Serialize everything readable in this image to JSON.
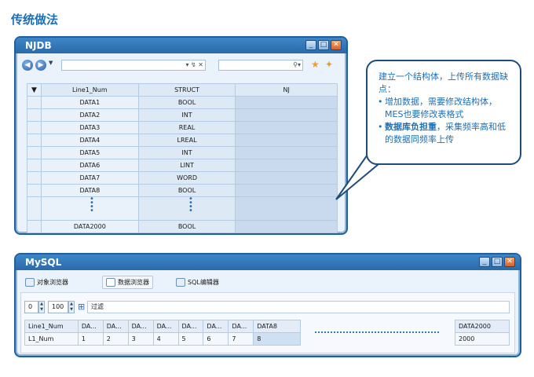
{
  "page_title": "传统做法",
  "njdb": {
    "title": "NJDB",
    "window_buttons": [
      "_",
      "□",
      "✕"
    ],
    "toolbar": {
      "back_icon": "back-arrow-icon",
      "forward_icon": "forward-arrow-icon",
      "search_icon": "search-icon",
      "star_icon": "star-icon"
    },
    "columns": [
      "Line1_Num",
      "STRUCT",
      "NJ"
    ],
    "sort_glyph": "▼",
    "rows": [
      [
        "DATA1",
        "BOOL"
      ],
      [
        "DATA2",
        "INT"
      ],
      [
        "DATA3",
        "REAL"
      ],
      [
        "DATA4",
        "LREAL"
      ],
      [
        "DATA5",
        "INT"
      ],
      [
        "DATA6",
        "LINT"
      ],
      [
        "DATA7",
        "WORD"
      ],
      [
        "DATA8",
        "BOOL"
      ]
    ],
    "last_row": [
      "DATA2000",
      "BOOL"
    ]
  },
  "callout": {
    "intro": "建立一个结构体，上传所有数据缺点：",
    "bullet1": "增加数据，需要修改结构体，MES也要修改表格式",
    "bullet2_bold": "数据库负担重",
    "bullet2_rest": "，采集频率高和低的数据同频率上传"
  },
  "mysql": {
    "title": "MySQL",
    "window_buttons": [
      "_",
      "□",
      "✕"
    ],
    "tabs": [
      "对象浏览器",
      "数据浏览器",
      "SQL编辑器"
    ],
    "active_tab": 1,
    "offset_value": "0",
    "limit_value": "100",
    "filter_label": "过滤",
    "header": [
      "Line1_Num",
      "DA...",
      "DA...",
      "DA...",
      "DA...",
      "DA...",
      "DA...",
      "DA...",
      "DATA8"
    ],
    "row": [
      "L1_Num",
      "1",
      "2",
      "3",
      "4",
      "5",
      "6",
      "7",
      "8"
    ],
    "last_header": "DATA2000",
    "last_value": "2000"
  }
}
